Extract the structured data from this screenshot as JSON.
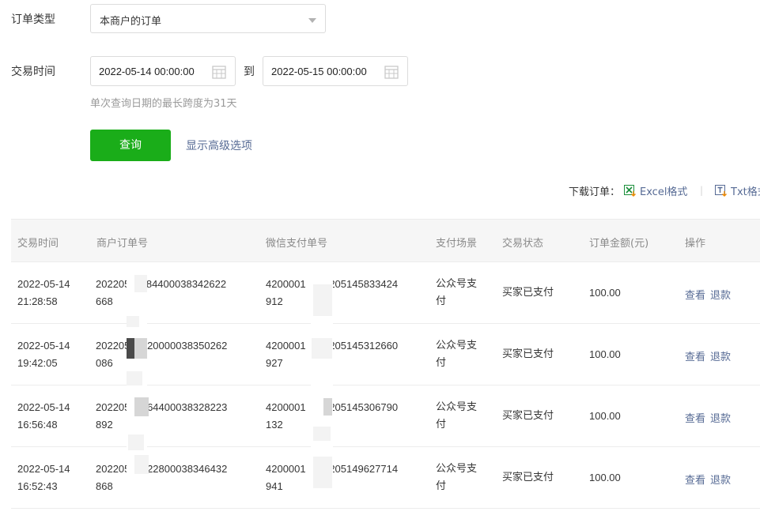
{
  "filters": {
    "order_type_label": "订单类型",
    "order_type_value": "本商户的订单",
    "time_label": "交易时间",
    "start_date": "2022-05-14 00:00:00",
    "to_label": "到",
    "end_date": "2022-05-15 00:00:00",
    "hint": "单次查询日期的最长跨度为31天",
    "query_button": "查询",
    "advanced_link": "显示高级选项"
  },
  "download": {
    "label": "下载订单：",
    "excel": "Excel格式",
    "separator": "|",
    "txt": "Txt格式"
  },
  "table": {
    "headers": [
      "交易时间",
      "商户订单号",
      "微信支付单号",
      "支付场景",
      "交易状态",
      "订单金额(元)",
      "操作"
    ],
    "rows": [
      {
        "date": "2022-05-14",
        "time": "21:28:58",
        "merchant1": "202205",
        "merchant2": "1284400038342622",
        "merchant3": "668",
        "wx1": "4200001",
        "wx2": "202205145833424",
        "wx3": "912",
        "scene1": "公众号支",
        "scene2": "付",
        "status": "买家已支付",
        "amount": "100.00",
        "view": "查看",
        "refund": "退款"
      },
      {
        "date": "2022-05-14",
        "time": "19:42:05",
        "merchant1": "202205",
        "merchant2": "19420000038350262",
        "merchant3": "086",
        "wx1": "4200001",
        "wx2": "202205145312660",
        "wx3": "927",
        "scene1": "公众号支",
        "scene2": "付",
        "status": "买家已支付",
        "amount": "100.00",
        "view": "查看",
        "refund": "退款"
      },
      {
        "date": "2022-05-14",
        "time": "16:56:48",
        "merchant1": "202205",
        "merchant2": "16564400038328223",
        "merchant3": "892",
        "wx1": "4200001",
        "wx2": "202205145306790",
        "wx3": "132",
        "scene1": "公众号支",
        "scene2": "付",
        "status": "买家已支付",
        "amount": "100.00",
        "view": "查看",
        "refund": "退款"
      },
      {
        "date": "2022-05-14",
        "time": "16:52:43",
        "merchant1": "202205",
        "merchant2": "16522800038346432",
        "merchant3": "868",
        "wx1": "4200001",
        "wx2": "202205149627714",
        "wx3": "941",
        "scene1": "公众号支",
        "scene2": "付",
        "status": "买家已支付",
        "amount": "100.00",
        "view": "查看",
        "refund": "退款"
      }
    ]
  },
  "colors": {
    "primary": "#1aad19",
    "link": "#576b95"
  }
}
